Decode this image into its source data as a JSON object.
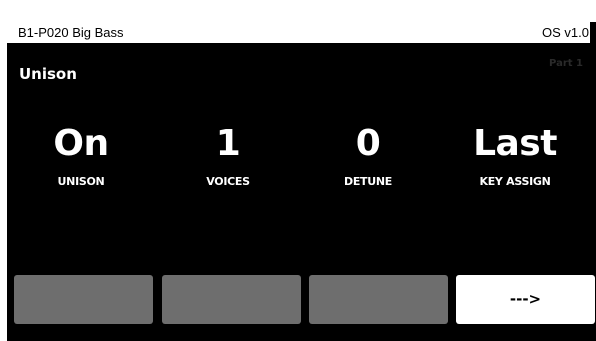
{
  "status_bar": {
    "preset_name": "B1-P020 Big Bass",
    "os_version": "OS v1.0"
  },
  "page": {
    "title": "Unison",
    "part_label": "Part 1"
  },
  "parameters": [
    {
      "value": "On",
      "label": "UNISON"
    },
    {
      "value": "1",
      "label": "VOICES"
    },
    {
      "value": "0",
      "label": "DETUNE"
    },
    {
      "value": "Last",
      "label": "KEY ASSIGN"
    }
  ],
  "softkeys": [
    {
      "label": ""
    },
    {
      "label": ""
    },
    {
      "label": ""
    },
    {
      "label": "--->"
    }
  ],
  "colors": {
    "screen_background": "#000000",
    "status_bar_background": "#ffffff",
    "softkey_inactive": "#6e6e6e",
    "softkey_active": "#ffffff",
    "text_primary": "#ffffff"
  }
}
